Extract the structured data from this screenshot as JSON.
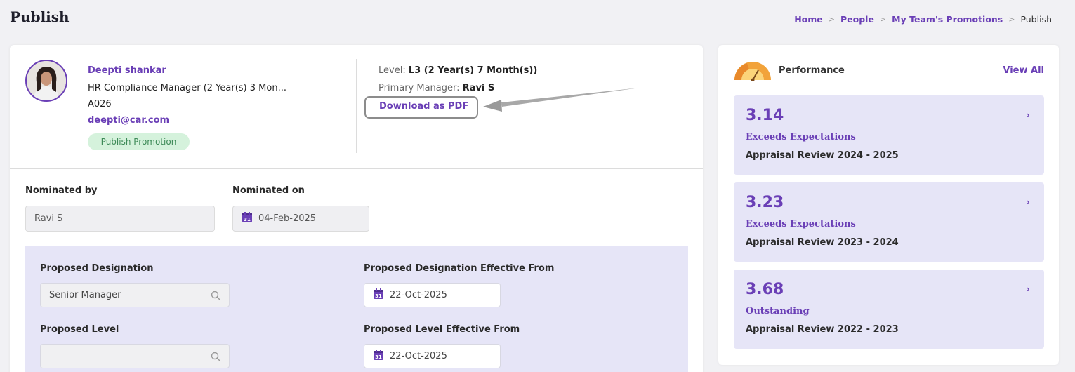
{
  "page": {
    "title": "Publish"
  },
  "breadcrumb": [
    "Home",
    "People",
    "My Team's Promotions",
    "Publish"
  ],
  "employee": {
    "name": "Deepti shankar",
    "role": "HR Compliance Manager (2 Year(s) 3 Mon...",
    "code": "A026",
    "email": "deepti@car.com",
    "status": "Publish Promotion",
    "level_label": "Level:",
    "level_value": "L3 (2 Year(s) 7 Month(s))",
    "manager_label": "Primary Manager:",
    "manager_value": "Ravi S",
    "download_label": "Download as PDF"
  },
  "nomination": {
    "by_label": "Nominated by",
    "by_value": "Ravi S",
    "on_label": "Nominated on",
    "on_value": "04-Feb-2025"
  },
  "proposal": {
    "designation_label": "Proposed Designation",
    "designation_value": "Senior Manager",
    "designation_eff_label": "Proposed Designation Effective From",
    "designation_eff_value": "22-Oct-2025",
    "level_label": "Proposed Level",
    "level_value": "",
    "level_eff_label": "Proposed Level Effective From",
    "level_eff_value": "22-Oct-2025"
  },
  "performance": {
    "title": "Performance",
    "view_all": "View All",
    "items": [
      {
        "score": "3.14",
        "rating": "Exceeds Expectations",
        "cycle": "Appraisal Review 2024 - 2025"
      },
      {
        "score": "3.23",
        "rating": "Exceeds Expectations",
        "cycle": "Appraisal Review 2023 - 2024"
      },
      {
        "score": "3.68",
        "rating": "Outstanding",
        "cycle": "Appraisal Review 2022 - 2023"
      }
    ]
  },
  "colors": {
    "accent": "#6a3fb6",
    "panel": "#e6e5f7",
    "badge_bg": "#d5f2dc",
    "badge_text": "#3d8a57"
  },
  "icons": [
    "calendar-icon",
    "search-icon",
    "chevron-right-icon",
    "performance-gauge-icon",
    "annotation-arrow"
  ]
}
